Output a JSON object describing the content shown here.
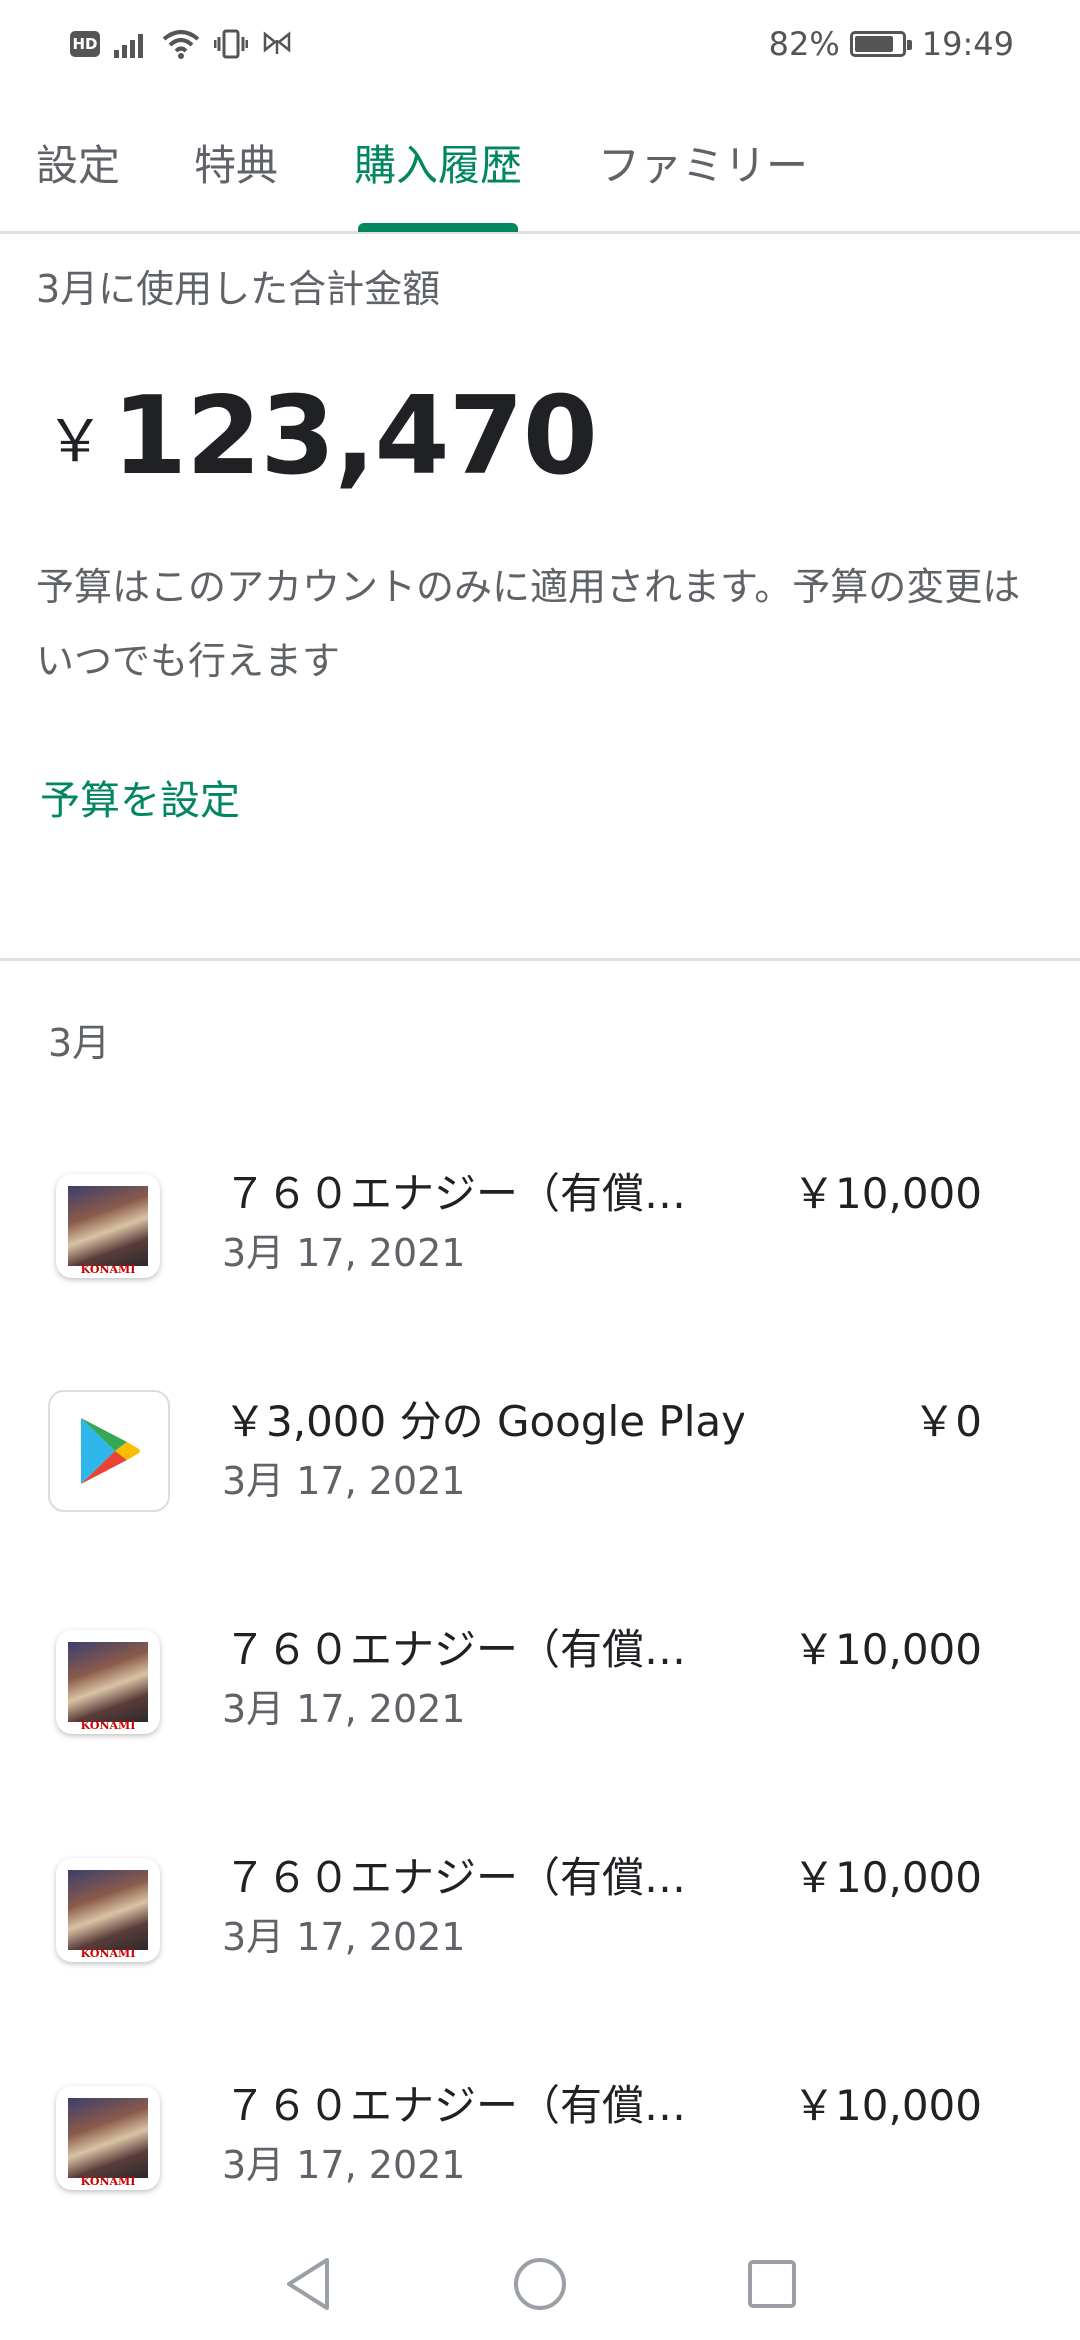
{
  "status_bar": {
    "hd": "HD",
    "battery_text": "82%",
    "battery_level": 0.82,
    "time": "19:49"
  },
  "tabs": [
    {
      "label": "設定",
      "active": false
    },
    {
      "label": "特典",
      "active": false
    },
    {
      "label": "購入履歴",
      "active": true
    },
    {
      "label": "ファミリー",
      "active": false
    }
  ],
  "summary": {
    "label": "3月に使用した合計金額",
    "currency": "￥",
    "total": "123,470",
    "description": "予算はこのアカウントのみに適用されます。予算の変更はいつでも行えます",
    "set_budget_link": "予算を設定"
  },
  "month_section": {
    "label": "3月"
  },
  "purchases": [
    {
      "icon": "konami-game-icon",
      "title": "７６０エナジー（有償…",
      "date": "3月 17, 2021",
      "price": "￥10,000"
    },
    {
      "icon": "google-play-icon",
      "title": "￥3,000 分の Google Play ク…",
      "date": "3月 17, 2021",
      "price": "￥0"
    },
    {
      "icon": "konami-game-icon",
      "title": "７６０エナジー（有償…",
      "date": "3月 17, 2021",
      "price": "￥10,000"
    },
    {
      "icon": "konami-game-icon",
      "title": "７６０エナジー（有償…",
      "date": "3月 17, 2021",
      "price": "￥10,000"
    },
    {
      "icon": "konami-game-icon",
      "title": "７６０エナジー（有償…",
      "date": "3月 17, 2021",
      "price": "￥10,000"
    }
  ],
  "game_icon_brand": "KONAMI",
  "nav_bar": {
    "icons": [
      "back-icon",
      "home-icon",
      "recents-icon"
    ]
  },
  "colors": {
    "accent": "#01875f",
    "text_primary": "#202124",
    "text_secondary": "#5f6368",
    "divider": "#e0e0e0"
  }
}
